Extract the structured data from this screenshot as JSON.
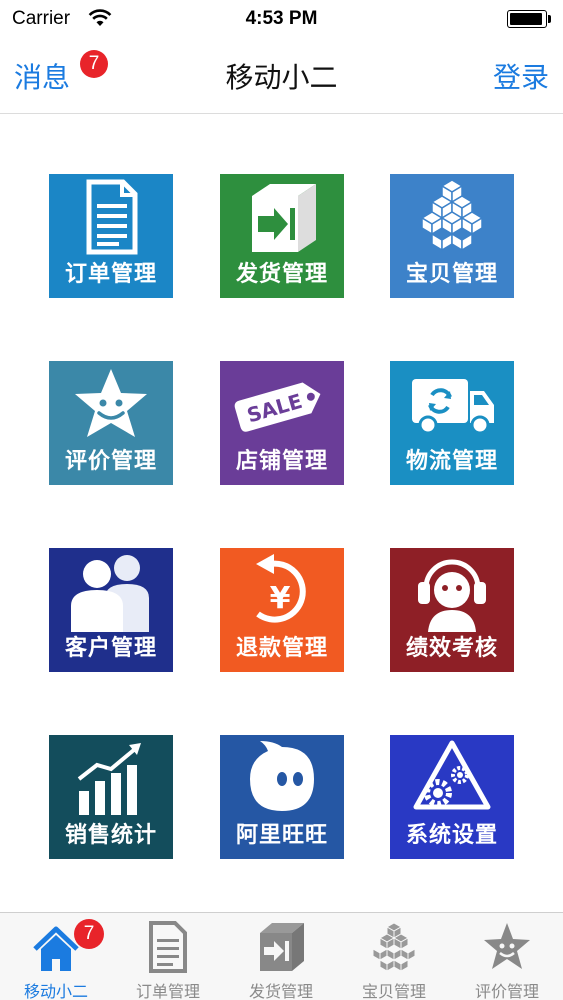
{
  "status_bar": {
    "carrier": "Carrier",
    "time": "4:53 PM",
    "battery_level": 0.95
  },
  "nav": {
    "left_label": "消息",
    "badge": "7",
    "title": "移动小二",
    "right_label": "登录"
  },
  "tiles": [
    {
      "label": "订单管理",
      "color": "#1b86c6",
      "icon": "document-icon"
    },
    {
      "label": "发货管理",
      "color": "#2e8f3e",
      "icon": "shipping-box-icon"
    },
    {
      "label": "宝贝管理",
      "color": "#3d82c9",
      "icon": "cube-stack-icon"
    },
    {
      "label": "评价管理",
      "color": "#3b88a8",
      "icon": "smiling-star-icon"
    },
    {
      "label": "店铺管理",
      "color": "#6a3d98",
      "icon": "sale-tag-icon"
    },
    {
      "label": "物流管理",
      "color": "#1a8fc3",
      "icon": "delivery-truck-icon"
    },
    {
      "label": "客户管理",
      "color": "#1f2f8c",
      "icon": "customers-icon"
    },
    {
      "label": "退款管理",
      "color": "#f15a22",
      "icon": "refund-yen-icon"
    },
    {
      "label": "绩效考核",
      "color": "#8e1f26",
      "icon": "headset-person-icon"
    },
    {
      "label": "销售统计",
      "color": "#134d5c",
      "icon": "sales-chart-icon"
    },
    {
      "label": "阿里旺旺",
      "color": "#2557a4",
      "icon": "wangwang-icon"
    },
    {
      "label": "系统设置",
      "color": "#2939c4",
      "icon": "settings-gears-icon"
    }
  ],
  "tabs": [
    {
      "label": "移动小二",
      "icon": "home-icon",
      "badge": "7",
      "active": true
    },
    {
      "label": "订单管理",
      "icon": "document-icon"
    },
    {
      "label": "发货管理",
      "icon": "shipping-box-icon"
    },
    {
      "label": "宝贝管理",
      "icon": "cube-stack-icon"
    },
    {
      "label": "评价管理",
      "icon": "smiling-star-icon"
    }
  ],
  "colors": {
    "accent": "#1b7be0",
    "badge": "#e8242a",
    "tab_inactive": "#8a8a8a"
  }
}
